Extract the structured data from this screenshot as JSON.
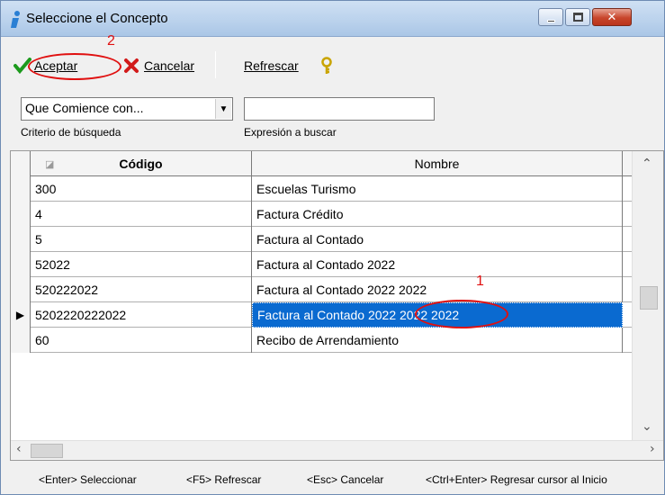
{
  "window": {
    "title": "Seleccione el Concepto",
    "controls": {
      "minimize": "—",
      "maximize": "□",
      "close": "✕"
    }
  },
  "toolbar": {
    "accept_label": "Aceptar",
    "cancel_label": "Cancelar",
    "refresh_label": "Refrescar",
    "help_icon": "key-icon"
  },
  "filter": {
    "criteria_value": "Que Comience con...",
    "criteria_label": "Criterio de búsqueda",
    "expression_value": "",
    "expression_label": "Expresión a buscar"
  },
  "grid": {
    "columns": [
      {
        "label": "Código"
      },
      {
        "label": "Nombre"
      }
    ],
    "rows": [
      {
        "codigo": "300",
        "nombre": "Escuelas Turismo",
        "selected": false
      },
      {
        "codigo": "4",
        "nombre": "Factura Crédito",
        "selected": false
      },
      {
        "codigo": "5",
        "nombre": "Factura al Contado",
        "selected": false
      },
      {
        "codigo": "52022",
        "nombre": "Factura al Contado 2022",
        "selected": false
      },
      {
        "codigo": "520222022",
        "nombre": "Factura al Contado 2022 2022",
        "selected": false
      },
      {
        "codigo": "5202220222022",
        "nombre": "Factura al Contado 2022 2022 2022",
        "selected": true
      },
      {
        "codigo": "60",
        "nombre": "Recibo de Arrendamiento",
        "selected": false
      }
    ]
  },
  "statusbar": {
    "items": [
      "<Enter> Seleccionar",
      "<F5> Refrescar",
      "<Esc> Cancelar",
      "<Ctrl+Enter> Regresar cursor al Inicio"
    ]
  },
  "annotations": {
    "one": "1",
    "two": "2"
  },
  "colors": {
    "selection": "#0a6ad0",
    "annotation": "#e01010",
    "titlebar": "#b9d1ec"
  }
}
